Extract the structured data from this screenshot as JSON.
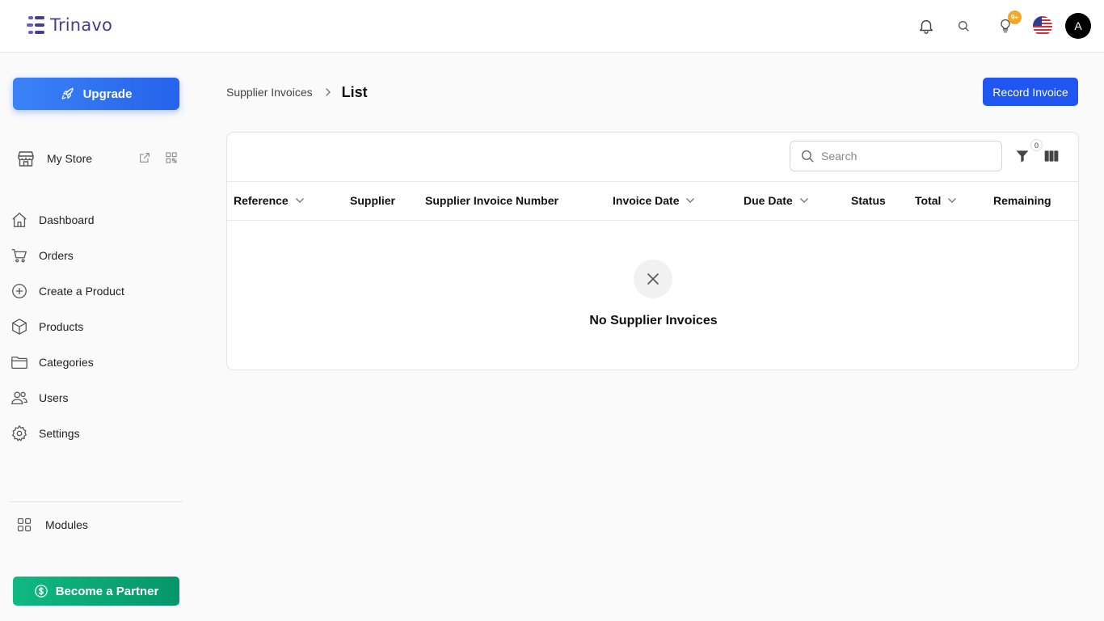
{
  "header": {
    "brand": "Trinavo",
    "notifications_badge": "9+",
    "avatar_initial": "A"
  },
  "sidebar": {
    "upgrade_label": "Upgrade",
    "store_label": "My Store",
    "items": [
      {
        "label": "Dashboard",
        "icon": "home-icon"
      },
      {
        "label": "Orders",
        "icon": "cart-icon"
      },
      {
        "label": "Create a Product",
        "icon": "plus-circle-icon"
      },
      {
        "label": "Products",
        "icon": "box-icon"
      },
      {
        "label": "Categories",
        "icon": "folder-icon"
      },
      {
        "label": "Users",
        "icon": "users-icon"
      },
      {
        "label": "Settings",
        "icon": "gear-icon"
      }
    ],
    "modules_label": "Modules",
    "partner_label": "Become a Partner"
  },
  "breadcrumb": {
    "parent": "Supplier Invoices",
    "current": "List"
  },
  "actions": {
    "record_invoice": "Record Invoice"
  },
  "table": {
    "search_placeholder": "Search",
    "filter_count": "0",
    "columns": [
      {
        "label": "Reference",
        "sortable": true
      },
      {
        "label": "Supplier",
        "sortable": false
      },
      {
        "label": "Supplier Invoice Number",
        "sortable": false
      },
      {
        "label": "Invoice Date",
        "sortable": true
      },
      {
        "label": "Due Date",
        "sortable": true
      },
      {
        "label": "Status",
        "sortable": false
      },
      {
        "label": "Total",
        "sortable": true
      },
      {
        "label": "Remaining",
        "sortable": false
      }
    ],
    "empty_message": "No Supplier Invoices"
  },
  "colors": {
    "primary": "#1f55f0",
    "brand": "#4b3b8f",
    "success": "#10b981",
    "badge": "#f5a623"
  }
}
